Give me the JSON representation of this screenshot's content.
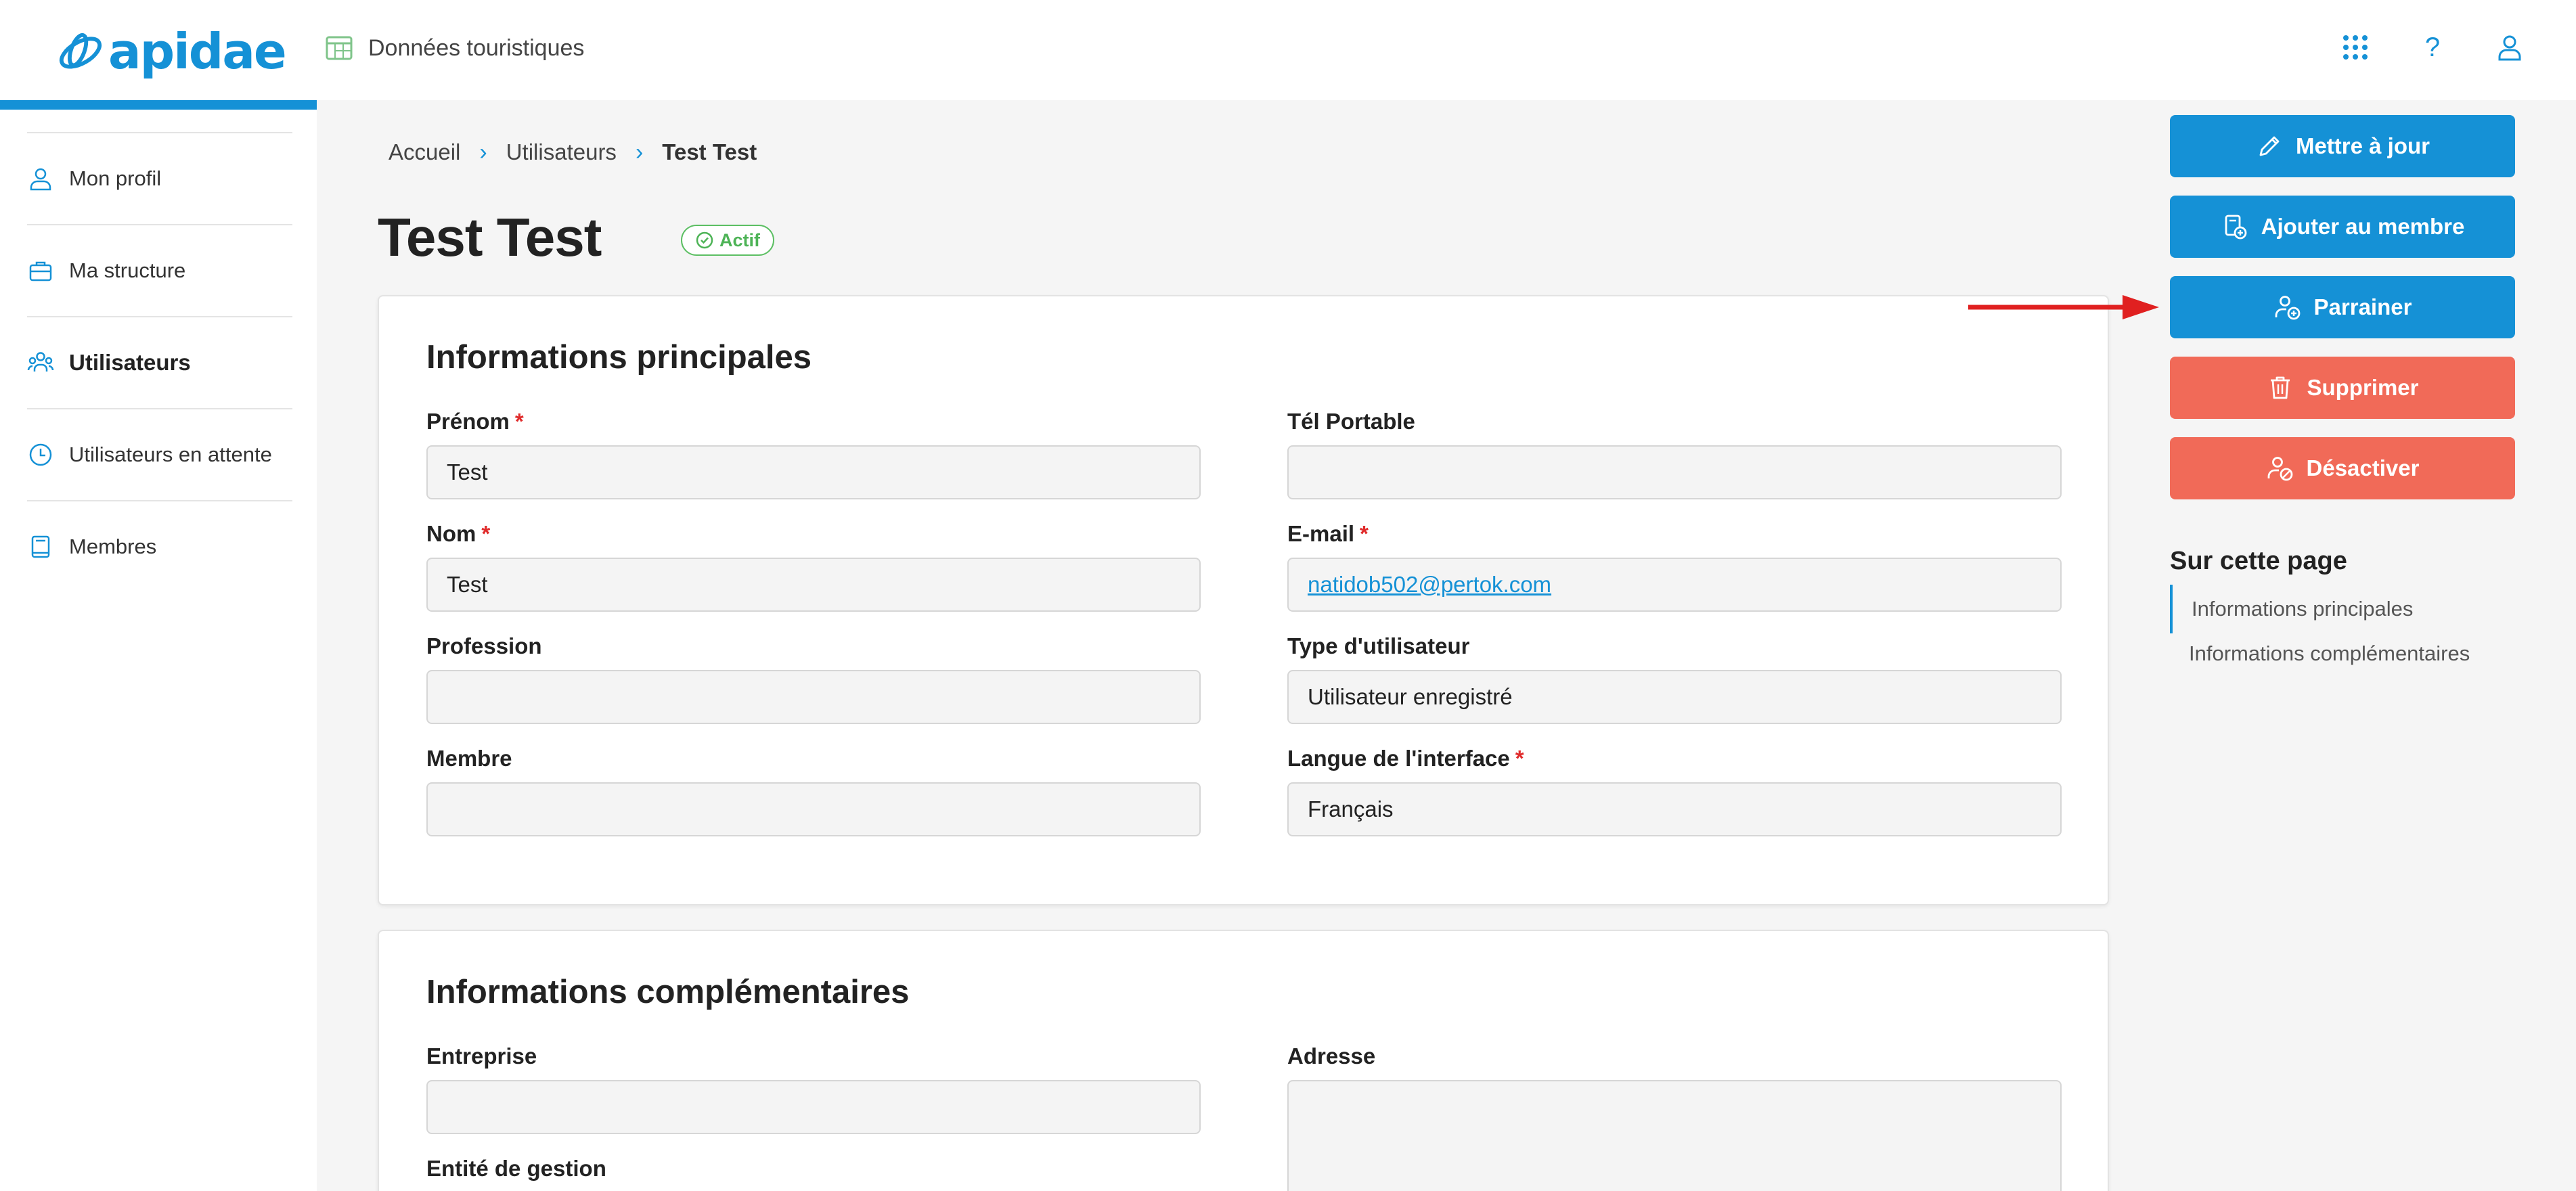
{
  "header": {
    "logo_text": "apidae",
    "app_label": "Données touristiques",
    "help_symbol": "?"
  },
  "sidebar": {
    "items": [
      {
        "label": "Mon profil",
        "icon": "user-icon"
      },
      {
        "label": "Ma structure",
        "icon": "briefcase-icon"
      },
      {
        "label": "Utilisateurs",
        "icon": "users-icon",
        "active": true
      },
      {
        "label": "Utilisateurs en attente",
        "icon": "clock-icon"
      },
      {
        "label": "Membres",
        "icon": "book-icon"
      }
    ]
  },
  "breadcrumb": {
    "items": [
      "Accueil",
      "Utilisateurs",
      "Test Test"
    ]
  },
  "page": {
    "title": "Test Test",
    "status": "Actif"
  },
  "main_info": {
    "title": "Informations principales",
    "fields": {
      "prenom": {
        "label": "Prénom",
        "value": "Test",
        "required": true
      },
      "tel": {
        "label": "Tél Portable",
        "value": ""
      },
      "nom": {
        "label": "Nom",
        "value": "Test",
        "required": true
      },
      "email": {
        "label": "E-mail",
        "value": "natidob502@pertok.com",
        "required": true
      },
      "profession": {
        "label": "Profession",
        "value": ""
      },
      "type": {
        "label": "Type d'utilisateur",
        "value": "Utilisateur enregistré"
      },
      "membre": {
        "label": "Membre",
        "value": ""
      },
      "langue": {
        "label": "Langue de l'interface",
        "value": "Français",
        "required": true
      }
    }
  },
  "extra_info": {
    "title": "Informations complémentaires",
    "fields": {
      "entreprise": {
        "label": "Entreprise",
        "value": ""
      },
      "adresse": {
        "label": "Adresse",
        "value": ""
      },
      "entite": {
        "label": "Entité de gestion"
      }
    }
  },
  "actions": {
    "update": "Mettre à jour",
    "add_member": "Ajouter au membre",
    "sponsor": "Parrainer",
    "delete": "Supprimer",
    "deactivate": "Désactiver"
  },
  "toc": {
    "title": "Sur cette page",
    "items": [
      "Informations principales",
      "Informations complémentaires"
    ]
  },
  "colors": {
    "primary": "#1591d6",
    "danger": "#f16a58",
    "success": "#5cbf63",
    "required": "#e02b2b",
    "annotation_arrow": "#e02020"
  }
}
